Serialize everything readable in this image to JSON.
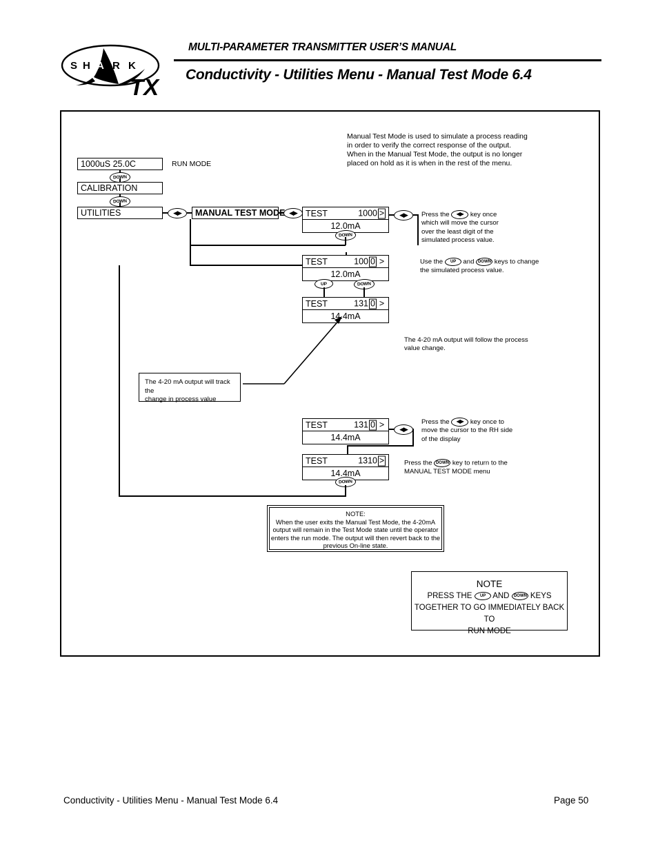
{
  "header": {
    "manual_title": "MULTI-PARAMETER TRANSMITTER USER’S MANUAL",
    "page_title": "Conductivity - Utilities Menu - Manual Test Mode 6.4",
    "logo_text": "S H A R K",
    "logo_model": "TX"
  },
  "intro": {
    "line1": "Manual Test Mode is used to simulate a process reading",
    "line2": "in order to verify the correct response of the output.",
    "line3": "When in the Manual Test Mode, the output is no longer",
    "line4": "placed on hold as it is when in the rest of the menu."
  },
  "menu": {
    "run_display": "1000uS  25.0C",
    "run_label": "RUN MODE",
    "calibration": "CALIBRATION",
    "utilities": "UTILITIES",
    "manual_test_mode": "MANUAL TEST MODE"
  },
  "keys": {
    "down": "DOWN",
    "up": "UP",
    "left_right": "◀▶"
  },
  "screens": {
    "s1": {
      "label": "TEST",
      "value": "1000",
      "cursor": ">",
      "cursor_boxed": true,
      "digit": "",
      "digit_boxed": false,
      "ma": "12.0mA"
    },
    "s2": {
      "label": "TEST",
      "value": "100",
      "digit": "0",
      "digit_boxed": true,
      "cursor": ">",
      "cursor_boxed": false,
      "ma": "12.0mA"
    },
    "s3": {
      "label": "TEST",
      "value": "131",
      "digit": "0",
      "digit_boxed": true,
      "cursor": ">",
      "cursor_boxed": false,
      "ma": "14.4mA"
    },
    "s4": {
      "label": "TEST",
      "value": "131",
      "digit": "0",
      "digit_boxed": true,
      "cursor": ">",
      "cursor_boxed": false,
      "ma": "14.4mA"
    },
    "s5": {
      "label": "TEST",
      "value": "1310",
      "digit": "",
      "digit_boxed": false,
      "cursor": ">",
      "cursor_boxed": true,
      "ma": "14.4mA"
    }
  },
  "captions": {
    "c1_l1": "Press the",
    "c1_l1b": "key once",
    "c1_l2": "which will move the cursor",
    "c1_l3": "over the least digit of the",
    "c1_l4": "simulated process value.",
    "c2_a": "Use the",
    "c2_b": "and",
    "c2_c": "keys to change",
    "c2_l2": "the simulated process value.",
    "c3_l1": "The 4-20 mA output will follow the process",
    "c3_l2": "value change.",
    "c4_l1": "Press the",
    "c4_l1b": "key once to",
    "c4_l2": "move the cursor  to the RH side",
    "c4_l3": "of the display",
    "c5_l1": "Press the",
    "c5_l1b": "key to return to the",
    "c5_l2": "MANUAL TEST MODE menu",
    "track_l1": "The 4-20 mA output will track the",
    "track_l2": "change in process value"
  },
  "note": {
    "title": "NOTE:",
    "line1": "When the user exits the Manual Test Mode, the 4-20mA",
    "line2": "output will remain in the Test Mode state until the operator",
    "line3": "enters the run mode. The output will then revert back to the",
    "line4": "previous On-line state."
  },
  "note_bottom": {
    "title": "NOTE",
    "l1a": "PRESS THE",
    "l1b": "AND",
    "l1c": "KEYS",
    "l2": "TOGETHER TO GO IMMEDIATELY BACK TO",
    "l3": "RUN MODE"
  },
  "footer": {
    "left": "Conductivity - Utilities Menu - Manual Test Mode 6.4",
    "right": "Page 50"
  }
}
